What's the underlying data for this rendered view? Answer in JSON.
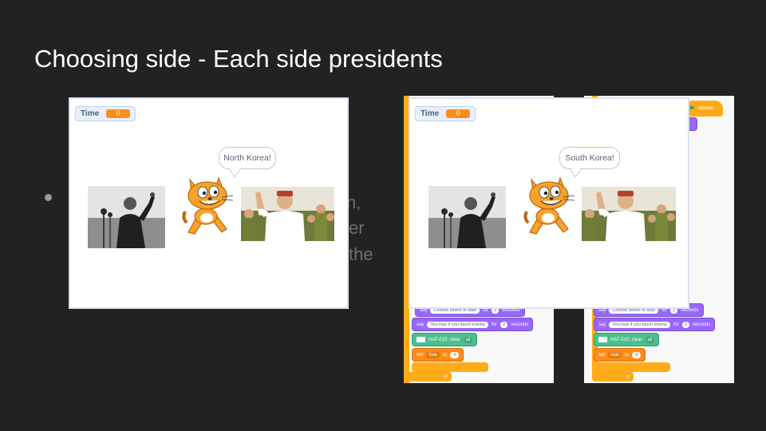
{
  "slide": {
    "title": "Choosing side - Each side presidents",
    "obscured_text": [
      "n,",
      "er",
      "the"
    ]
  },
  "stage_left": {
    "variable": {
      "name": "Time",
      "value": "0"
    },
    "speech": "North Korea!"
  },
  "stage_right": {
    "variable": {
      "name": "Time",
      "value": "0"
    },
    "speech": "South Korea!"
  },
  "code_panel_1": {
    "blocks": [
      {
        "op": "say",
        "text": "Choose where to start",
        "secs_label": "for",
        "secs": "2",
        "unit": "seconds"
      },
      {
        "op": "say",
        "text": "You lose if you touch enemy",
        "secs_label": "for",
        "secs": "2",
        "unit": "seconds"
      },
      {
        "op": "HAT-010: clear",
        "value": "all"
      },
      {
        "op": "set",
        "var": "Side",
        "to": "to",
        "value": "-5"
      }
    ]
  },
  "code_panel_2": {
    "hat": "clicked",
    "blocks": [
      {
        "op": "say",
        "text": "Choose where to start",
        "secs_label": "for",
        "secs": "2",
        "unit": "seconds"
      },
      {
        "op": "say",
        "text": "You lose if you touch enemy",
        "secs_label": "for",
        "secs": "2",
        "unit": "seconds"
      },
      {
        "op": "HAT-010: clear",
        "value": "all"
      },
      {
        "op": "set",
        "var": "Side",
        "to": "to",
        "value": "-5"
      }
    ]
  },
  "colors": {
    "background": "#222222",
    "variable_orange": "#ff8c1a",
    "looks_purple": "#9966ff",
    "extension_green": "#4cbf8f",
    "control_yellow": "#ffab19"
  }
}
